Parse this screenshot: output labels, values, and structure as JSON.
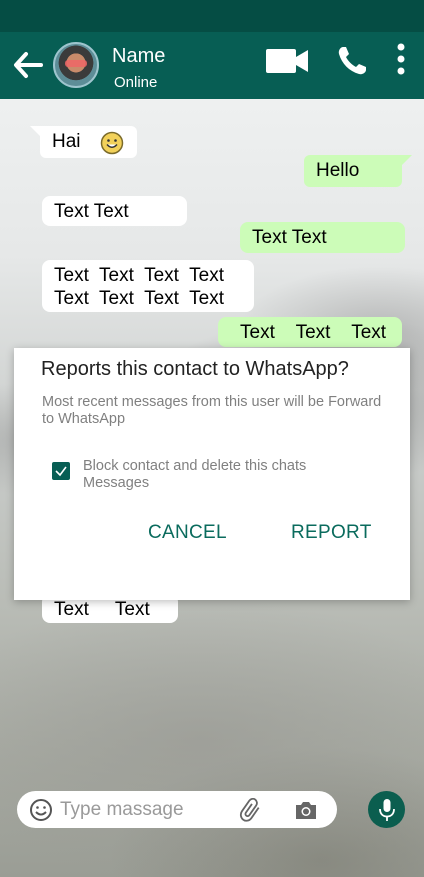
{
  "header": {
    "name": "Name",
    "status": "Online"
  },
  "messages": [
    {
      "text": "Hai",
      "type": "incoming"
    },
    {
      "text": "Hello",
      "type": "outgoing"
    },
    {
      "text": "Text  Text",
      "type": "incoming"
    },
    {
      "text": "Text  Text",
      "type": "outgoing"
    },
    {
      "line1": "Text  Text  Text  Text",
      "line2": "Text  Text  Text  Text",
      "type": "incoming"
    },
    {
      "text": "Text    Text    Text",
      "type": "outgoing"
    },
    {
      "text": "Text     Text",
      "type": "incoming"
    }
  ],
  "dialog": {
    "title": "Reports this contact to WhatsApp?",
    "body": "Most recent messages from this user will be Forward to WhatsApp",
    "checkbox_label": "Block contact and delete this chats Messages",
    "checkbox_checked": true,
    "cancel_label": "CANCEL",
    "report_label": "REPORT"
  },
  "composer": {
    "placeholder": "Type massage"
  },
  "icons": {
    "back": "back-arrow-icon",
    "video": "video-call-icon",
    "call": "phone-icon",
    "more": "more-vert-icon",
    "emoji": "emoji-icon",
    "attach": "attach-icon",
    "camera": "camera-icon",
    "mic": "mic-icon"
  },
  "colors": {
    "header": "#075e54",
    "status_bar": "#054d44",
    "outgoing_bubble": "#ccfcb8",
    "accent": "#0a6b5d"
  }
}
